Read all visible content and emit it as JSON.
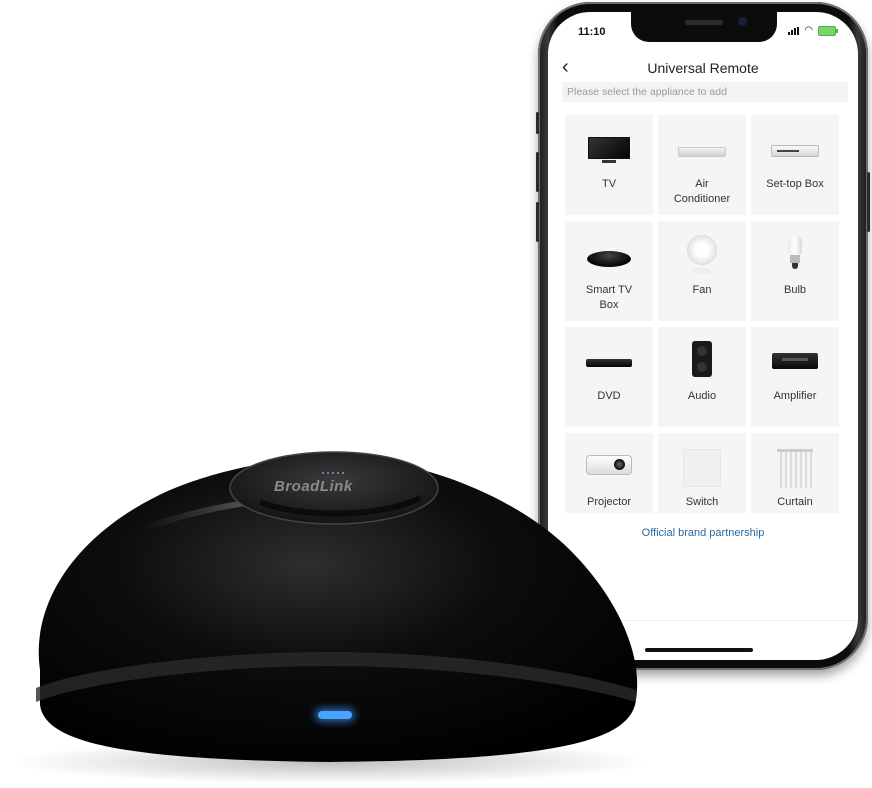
{
  "phone": {
    "status_bar": {
      "time": "11:10",
      "icons": [
        "cellular-signal-icon",
        "wifi-icon",
        "battery-charging-icon"
      ]
    },
    "nav": {
      "back_icon": "chevron-left-icon",
      "back_glyph": "‹",
      "title": "Universal Remote"
    },
    "hint": "Please select the appliance to add",
    "appliances": [
      {
        "label": "TV",
        "icon": "tv-icon"
      },
      {
        "label": "Air Conditioner",
        "icon": "air-conditioner-icon"
      },
      {
        "label": "Set-top Box",
        "icon": "set-top-box-icon"
      },
      {
        "label": "Smart TV Box",
        "icon": "smart-tv-box-icon"
      },
      {
        "label": "Fan",
        "icon": "fan-icon"
      },
      {
        "label": "Bulb",
        "icon": "bulb-icon"
      },
      {
        "label": "DVD",
        "icon": "dvd-player-icon"
      },
      {
        "label": "Audio",
        "icon": "speaker-icon"
      },
      {
        "label": "Amplifier",
        "icon": "amplifier-icon"
      },
      {
        "label": "Projector",
        "icon": "projector-icon"
      },
      {
        "label": "Switch",
        "icon": "wall-switch-icon"
      },
      {
        "label": "Curtain",
        "icon": "curtain-icon"
      }
    ],
    "footer_link": "Official brand partnership"
  },
  "device": {
    "brand": "BroadLink",
    "led_color": "#4aa3ff"
  },
  "colors": {
    "link": "#2a6aa0",
    "tile_bg": "#f5f5f5",
    "hint_bg": "#f3f3f3"
  }
}
